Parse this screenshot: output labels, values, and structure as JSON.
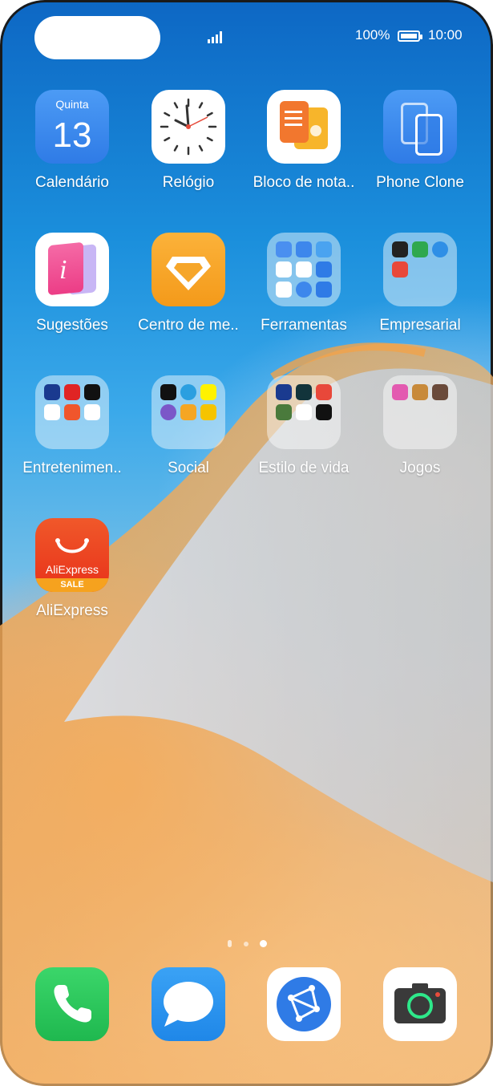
{
  "status_bar": {
    "battery": "100%",
    "time": "10:00"
  },
  "apps": [
    {
      "id": "calendario",
      "label": "Calendário",
      "calendar_day_name": "Quinta",
      "calendar_day": "13"
    },
    {
      "id": "relogio",
      "label": "Relógio"
    },
    {
      "id": "bloco-notas",
      "label": "Bloco de nota.."
    },
    {
      "id": "phone-clone",
      "label": "Phone Clone"
    },
    {
      "id": "sugestoes",
      "label": "Sugestões"
    },
    {
      "id": "centro-membros",
      "label": "Centro de me.."
    },
    {
      "id": "ferramentas",
      "label": "Ferramentas"
    },
    {
      "id": "empresarial",
      "label": "Empresarial"
    },
    {
      "id": "entretenimento",
      "label": "Entretenimen.."
    },
    {
      "id": "social",
      "label": "Social"
    },
    {
      "id": "estilo-vida",
      "label": "Estilo de vida"
    },
    {
      "id": "jogos",
      "label": "Jogos"
    },
    {
      "id": "aliexpress",
      "label": "AliExpress",
      "icon_text": "AliExpress",
      "badge": "SALE"
    }
  ],
  "page_indicator": {
    "pages": 3,
    "current": 3
  },
  "dock": [
    {
      "id": "phone",
      "icon": "phone-icon"
    },
    {
      "id": "messages",
      "icon": "message-icon"
    },
    {
      "id": "browser",
      "icon": "browser-icon"
    },
    {
      "id": "camera",
      "icon": "camera-icon"
    }
  ],
  "colors": {
    "accent": "#2f7be6",
    "aliexpress_red": "#e8321a"
  }
}
